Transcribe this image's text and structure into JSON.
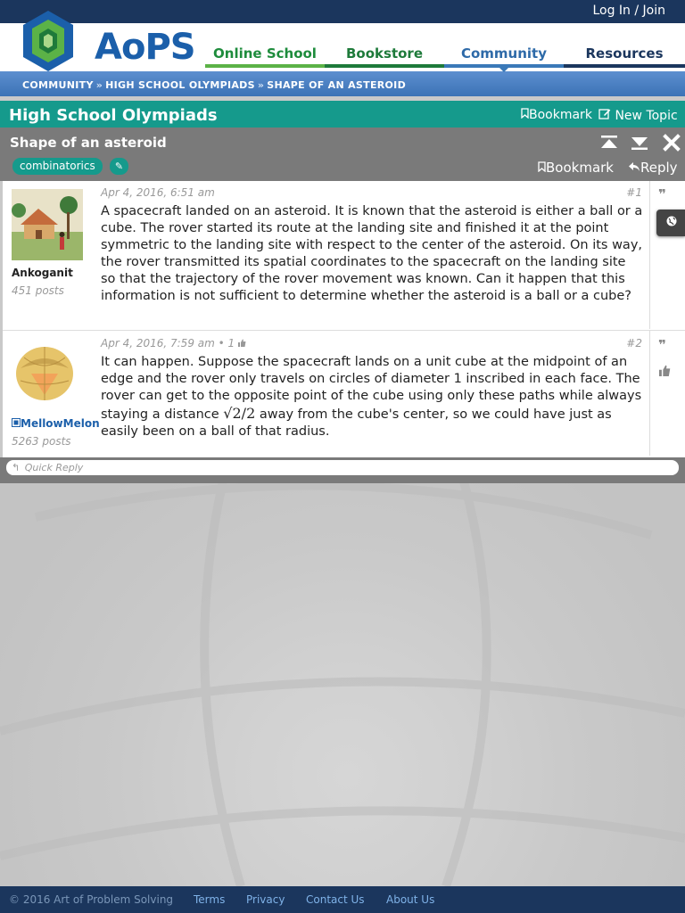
{
  "header": {
    "login_label": "Log In / Join",
    "logo_text": "AoPS",
    "nav": {
      "online_school": "Online School",
      "bookstore": "Bookstore",
      "community": "Community",
      "resources": "Resources"
    }
  },
  "breadcrumb": {
    "community": "COMMUNITY",
    "forum": "HIGH SCHOOL OLYMPIADS",
    "topic": "SHAPE OF AN ASTEROID",
    "separator": "»"
  },
  "forum": {
    "title": "High School Olympiads",
    "bookmark_label": "Bookmark",
    "new_topic_label": "New Topic"
  },
  "topic": {
    "title": "Shape of an asteroid",
    "tag": "combinatorics",
    "bookmark_label": "Bookmark",
    "reply_label": "Reply"
  },
  "posts": [
    {
      "username": "Ankoganit",
      "post_count": "451 posts",
      "timestamp": "Apr 4, 2016, 6:51 am",
      "number": "#1",
      "text": "A spacecraft landed on an asteroid. It is known that the asteroid is either a ball or a cube. The rover started its route at the landing site and finished it at the point symmetric to the landing site with respect to the center of the asteroid. On its way, the rover transmitted its spatial coordinates to the spacecraft on the landing site so that the trajectory of the rover movement was known. Can it happen that this information is not sufficient to determine whether the asteroid is a ball or a cube?"
    },
    {
      "username": "MellowMelon",
      "post_count": "5263 posts",
      "timestamp": "Apr 4, 2016, 7:59 am",
      "likes": "• 1",
      "number": "#2",
      "text_before": "It can happen. Suppose the spacecraft lands on a unit cube at the midpoint of an edge and the rover only travels on circles of diameter 1 inscribed in each face. The rover can get to the opposite point of the cube using only these paths while always staying a distance",
      "math": "√2/2",
      "text_after": "away from the cube's center, so we could have just as easily been on a ball of that radius."
    }
  ],
  "quick_reply": "Quick Reply",
  "footer": {
    "copyright": "© 2016 Art of Problem Solving",
    "links": [
      "Terms",
      "Privacy",
      "Contact Us",
      "About Us"
    ]
  }
}
